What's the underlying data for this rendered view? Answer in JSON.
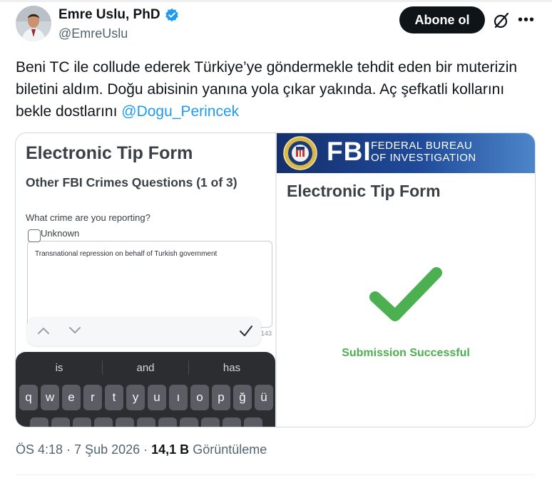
{
  "header": {
    "display_name": "Emre Uslu, PhD",
    "handle": "@EmreUslu",
    "follow_label": "Abone ol",
    "verified_color": "#1d9bf0"
  },
  "tweet": {
    "text_before_mention": "Beni TC ile collude ederek Türkiye’ye göndermekle tehdit eden bir muterizin biletini aldım. Doğu abisinin yanına yola çıkar yakında. Aç şefkatli kollarını bekle dostlarını",
    "mention": "@Dogu_Perincek"
  },
  "media": {
    "left": {
      "title": "Electronic Tip Form",
      "subtitle": "Other FBI Crimes Questions (1 of 3)",
      "question": "What crime are you reporting?",
      "checkbox_label": "Unknown",
      "textarea_value": "Transnational repression on behalf of Turkish government",
      "char_count": "143",
      "keyboard": {
        "suggestions": [
          "is",
          "and",
          "has"
        ],
        "row1": [
          "q",
          "w",
          "e",
          "r",
          "t",
          "y",
          "u",
          "ı",
          "o",
          "p",
          "ğ",
          "ü"
        ]
      }
    },
    "right": {
      "banner_letters": "FBI",
      "banner_line1": "FEDERAL BUREAU",
      "banner_line2": "OF INVESTIGATION",
      "title": "Electronic Tip Form",
      "success_text": "Submission Successful",
      "success_color": "#4caf50"
    }
  },
  "meta": {
    "time": "ÖS 4:18",
    "date": "7 Şub 2026",
    "views_count": "14,1 B",
    "views_label": "Görüntüleme",
    "separator": "·"
  }
}
